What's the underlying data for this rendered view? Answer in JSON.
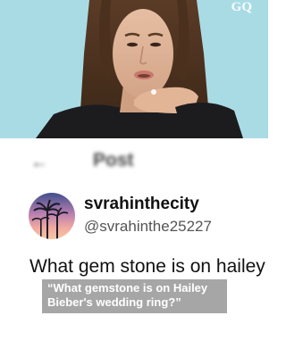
{
  "video": {
    "brand_logo": "GQ"
  },
  "post": {
    "header_back_icon": "back-arrow-icon",
    "header_title": "Post",
    "display_name": "svrahinthecity",
    "handle": "@svrahinthe25227",
    "text": "What gem stone is on hailey"
  },
  "caption": {
    "line1": "“What gemstone is on Hailey",
    "line2": "Bieber's wedding ring?”"
  }
}
